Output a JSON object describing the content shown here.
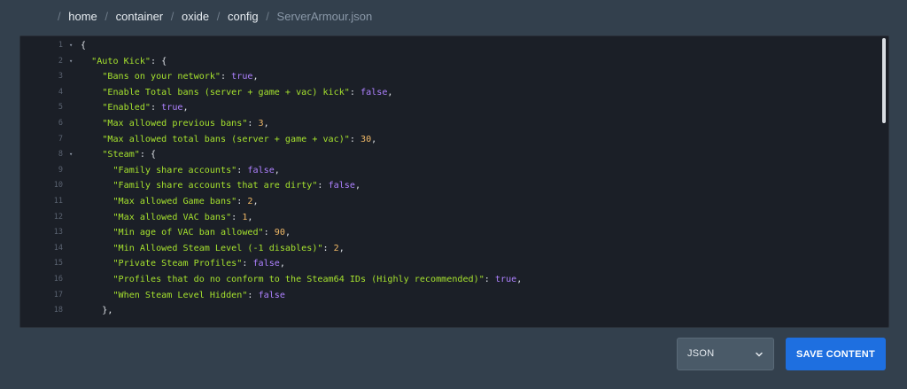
{
  "breadcrumb": {
    "leading_sep": "/",
    "parts": [
      "home",
      "container",
      "oxide",
      "config"
    ],
    "current": "ServerArmour.json"
  },
  "editor": {
    "lines": [
      {
        "n": "1",
        "fold": true,
        "tokens": [
          {
            "t": "p",
            "v": "{"
          }
        ]
      },
      {
        "n": "2",
        "fold": true,
        "tokens": [
          {
            "t": "p",
            "v": "  "
          },
          {
            "t": "k",
            "v": "\"Auto Kick\""
          },
          {
            "t": "p",
            "v": ": {"
          }
        ]
      },
      {
        "n": "3",
        "fold": false,
        "tokens": [
          {
            "t": "p",
            "v": "    "
          },
          {
            "t": "k",
            "v": "\"Bans on your network\""
          },
          {
            "t": "p",
            "v": ": "
          },
          {
            "t": "b",
            "v": "true"
          },
          {
            "t": "p",
            "v": ","
          }
        ]
      },
      {
        "n": "4",
        "fold": false,
        "tokens": [
          {
            "t": "p",
            "v": "    "
          },
          {
            "t": "k",
            "v": "\"Enable Total bans (server + game + vac) kick\""
          },
          {
            "t": "p",
            "v": ": "
          },
          {
            "t": "b",
            "v": "false"
          },
          {
            "t": "p",
            "v": ","
          }
        ]
      },
      {
        "n": "5",
        "fold": false,
        "tokens": [
          {
            "t": "p",
            "v": "    "
          },
          {
            "t": "k",
            "v": "\"Enabled\""
          },
          {
            "t": "p",
            "v": ": "
          },
          {
            "t": "b",
            "v": "true"
          },
          {
            "t": "p",
            "v": ","
          }
        ]
      },
      {
        "n": "6",
        "fold": false,
        "tokens": [
          {
            "t": "p",
            "v": "    "
          },
          {
            "t": "k",
            "v": "\"Max allowed previous bans\""
          },
          {
            "t": "p",
            "v": ": "
          },
          {
            "t": "n",
            "v": "3"
          },
          {
            "t": "p",
            "v": ","
          }
        ]
      },
      {
        "n": "7",
        "fold": false,
        "tokens": [
          {
            "t": "p",
            "v": "    "
          },
          {
            "t": "k",
            "v": "\"Max allowed total bans (server + game + vac)\""
          },
          {
            "t": "p",
            "v": ": "
          },
          {
            "t": "n",
            "v": "30"
          },
          {
            "t": "p",
            "v": ","
          }
        ]
      },
      {
        "n": "8",
        "fold": true,
        "tokens": [
          {
            "t": "p",
            "v": "    "
          },
          {
            "t": "k",
            "v": "\"Steam\""
          },
          {
            "t": "p",
            "v": ": {"
          }
        ]
      },
      {
        "n": "9",
        "fold": false,
        "tokens": [
          {
            "t": "p",
            "v": "      "
          },
          {
            "t": "k",
            "v": "\"Family share accounts\""
          },
          {
            "t": "p",
            "v": ": "
          },
          {
            "t": "b",
            "v": "false"
          },
          {
            "t": "p",
            "v": ","
          }
        ]
      },
      {
        "n": "10",
        "fold": false,
        "tokens": [
          {
            "t": "p",
            "v": "      "
          },
          {
            "t": "k",
            "v": "\"Family share accounts that are dirty\""
          },
          {
            "t": "p",
            "v": ": "
          },
          {
            "t": "b",
            "v": "false"
          },
          {
            "t": "p",
            "v": ","
          }
        ]
      },
      {
        "n": "11",
        "fold": false,
        "tokens": [
          {
            "t": "p",
            "v": "      "
          },
          {
            "t": "k",
            "v": "\"Max allowed Game bans\""
          },
          {
            "t": "p",
            "v": ": "
          },
          {
            "t": "n",
            "v": "2"
          },
          {
            "t": "p",
            "v": ","
          }
        ]
      },
      {
        "n": "12",
        "fold": false,
        "tokens": [
          {
            "t": "p",
            "v": "      "
          },
          {
            "t": "k",
            "v": "\"Max allowed VAC bans\""
          },
          {
            "t": "p",
            "v": ": "
          },
          {
            "t": "n",
            "v": "1"
          },
          {
            "t": "p",
            "v": ","
          }
        ]
      },
      {
        "n": "13",
        "fold": false,
        "tokens": [
          {
            "t": "p",
            "v": "      "
          },
          {
            "t": "k",
            "v": "\"Min age of VAC ban allowed\""
          },
          {
            "t": "p",
            "v": ": "
          },
          {
            "t": "n",
            "v": "90"
          },
          {
            "t": "p",
            "v": ","
          }
        ]
      },
      {
        "n": "14",
        "fold": false,
        "tokens": [
          {
            "t": "p",
            "v": "      "
          },
          {
            "t": "k",
            "v": "\"Min Allowed Steam Level (-1 disables)\""
          },
          {
            "t": "p",
            "v": ": "
          },
          {
            "t": "n",
            "v": "2"
          },
          {
            "t": "p",
            "v": ","
          }
        ]
      },
      {
        "n": "15",
        "fold": false,
        "tokens": [
          {
            "t": "p",
            "v": "      "
          },
          {
            "t": "k",
            "v": "\"Private Steam Profiles\""
          },
          {
            "t": "p",
            "v": ": "
          },
          {
            "t": "b",
            "v": "false"
          },
          {
            "t": "p",
            "v": ","
          }
        ]
      },
      {
        "n": "16",
        "fold": false,
        "tokens": [
          {
            "t": "p",
            "v": "      "
          },
          {
            "t": "k",
            "v": "\"Profiles that do no conform to the Steam64 IDs (Highly recommended)\""
          },
          {
            "t": "p",
            "v": ": "
          },
          {
            "t": "b",
            "v": "true"
          },
          {
            "t": "p",
            "v": ","
          }
        ]
      },
      {
        "n": "17",
        "fold": false,
        "tokens": [
          {
            "t": "p",
            "v": "      "
          },
          {
            "t": "k",
            "v": "\"When Steam Level Hidden\""
          },
          {
            "t": "p",
            "v": ": "
          },
          {
            "t": "b",
            "v": "false"
          }
        ]
      },
      {
        "n": "18",
        "fold": false,
        "tokens": [
          {
            "t": "p",
            "v": "    },"
          }
        ]
      }
    ]
  },
  "format_select": {
    "value": "JSON"
  },
  "save_button": {
    "label": "SAVE CONTENT"
  },
  "colors": {
    "key": "#a6e22e",
    "boolean": "#ae81ff",
    "number": "#f0b866",
    "accent": "#1e6fe0"
  }
}
